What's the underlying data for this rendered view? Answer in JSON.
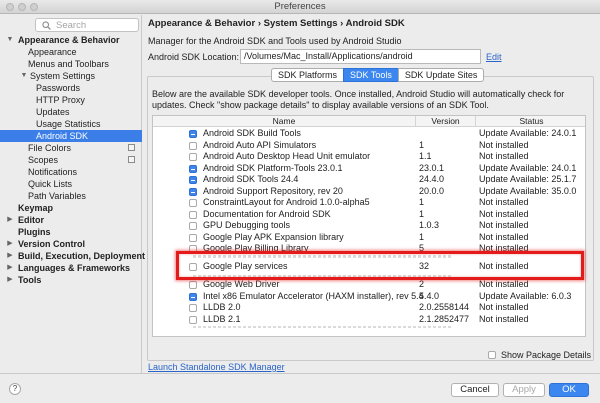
{
  "window": {
    "title": "Preferences"
  },
  "search": {
    "placeholder": "Search"
  },
  "tree": [
    {
      "label": "Appearance & Behavior",
      "level": 0,
      "arrow": "▼",
      "bold": true
    },
    {
      "label": "Appearance",
      "level": 2
    },
    {
      "label": "Menus and Toolbars",
      "level": 2
    },
    {
      "label": "System Settings",
      "level": 1,
      "arrow": "▼"
    },
    {
      "label": "Passwords",
      "level": 3
    },
    {
      "label": "HTTP Proxy",
      "level": 3
    },
    {
      "label": "Updates",
      "level": 3
    },
    {
      "label": "Usage Statistics",
      "level": 3
    },
    {
      "label": "Android SDK",
      "level": 3,
      "selected": true
    },
    {
      "label": "File Colors",
      "level": 2,
      "copy": true
    },
    {
      "label": "Scopes",
      "level": 2,
      "copy": true
    },
    {
      "label": "Notifications",
      "level": 2
    },
    {
      "label": "Quick Lists",
      "level": 2
    },
    {
      "label": "Path Variables",
      "level": 2
    },
    {
      "label": "Keymap",
      "level": 0,
      "bold": true
    },
    {
      "label": "Editor",
      "level": 0,
      "arrow": "▶",
      "bold": true
    },
    {
      "label": "Plugins",
      "level": 0,
      "bold": true
    },
    {
      "label": "Version Control",
      "level": 0,
      "arrow": "▶",
      "bold": true
    },
    {
      "label": "Build, Execution, Deployment",
      "level": 0,
      "arrow": "▶",
      "bold": true
    },
    {
      "label": "Languages & Frameworks",
      "level": 0,
      "arrow": "▶",
      "bold": true
    },
    {
      "label": "Tools",
      "level": 0,
      "arrow": "▶",
      "bold": true
    }
  ],
  "content": {
    "breadcrumb": "Appearance & Behavior › System Settings › Android SDK",
    "description": "Manager for the Android SDK and Tools used by Android Studio",
    "location_label": "Android SDK Location:",
    "location_value": "/Volumes/Mac_Install/Applications/android",
    "edit_label": "Edit"
  },
  "tabs": [
    {
      "label": "SDK Platforms",
      "active": false
    },
    {
      "label": "SDK Tools",
      "active": true
    },
    {
      "label": "SDK Update Sites",
      "active": false
    }
  ],
  "info_text": "Below are the available SDK developer tools. Once installed, Android Studio will automatically check for updates. Check \"show package details\" to display available versions of an SDK Tool.",
  "table": {
    "headers": {
      "name": "Name",
      "version": "Version",
      "status": "Status"
    },
    "rows": [
      {
        "checkbox": "partial",
        "name": "Android SDK Build Tools",
        "version": "",
        "status": "Update Available: 24.0.1"
      },
      {
        "checkbox": "none",
        "name": "Android Auto API Simulators",
        "version": "1",
        "status": "Not installed"
      },
      {
        "checkbox": "none",
        "name": "Android Auto Desktop Head Unit emulator",
        "version": "1.1",
        "status": "Not installed"
      },
      {
        "checkbox": "partial",
        "name": "Android SDK Platform-Tools 23.0.1",
        "version": "23.0.1",
        "status": "Update Available: 24.0.1"
      },
      {
        "checkbox": "partial",
        "name": "Android SDK Tools 24.4",
        "version": "24.4.0",
        "status": "Update Available: 25.1.7"
      },
      {
        "checkbox": "partial",
        "name": "Android Support Repository, rev 20",
        "version": "20.0.0",
        "status": "Update Available: 35.0.0"
      },
      {
        "checkbox": "none",
        "name": "ConstraintLayout for Android 1.0.0-alpha5",
        "version": "1",
        "status": "Not installed"
      },
      {
        "checkbox": "none",
        "name": "Documentation for Android SDK",
        "version": "1",
        "status": "Not installed"
      },
      {
        "checkbox": "none",
        "name": "GPU Debugging tools",
        "version": "1.0.3",
        "status": "Not installed"
      },
      {
        "checkbox": "none",
        "name": "Google Play APK Expansion library",
        "version": "1",
        "status": "Not installed"
      },
      {
        "checkbox": "none",
        "name": "Google Play Billing Library",
        "version": "5",
        "status": "Not installed"
      },
      {
        "checkbox": "none",
        "name": "Google Play services",
        "version": "32",
        "status": "Not installed",
        "highlight": true
      },
      {
        "checkbox": "none",
        "name": "Google Web Driver",
        "version": "2",
        "status": "Not installed"
      },
      {
        "checkbox": "partial",
        "name": "Intel x86 Emulator Accelerator (HAXM installer), rev 5.4",
        "version": "5.4.0",
        "status": "Update Available: 6.0.3"
      },
      {
        "checkbox": "none",
        "name": "LLDB 2.0",
        "version": "2.0.2558144",
        "status": "Not installed"
      },
      {
        "checkbox": "none",
        "name": "LLDB 2.1",
        "version": "2.1.2852477",
        "status": "Not installed"
      }
    ]
  },
  "show_package_details": "Show Package Details",
  "launch_link": "Launch Standalone SDK Manager",
  "buttons": {
    "help": "?",
    "cancel": "Cancel",
    "apply": "Apply",
    "ok": "OK"
  },
  "colors": {
    "accent": "#3b86ef",
    "highlight_box": "#e41b1b",
    "link": "#2a64c8"
  }
}
